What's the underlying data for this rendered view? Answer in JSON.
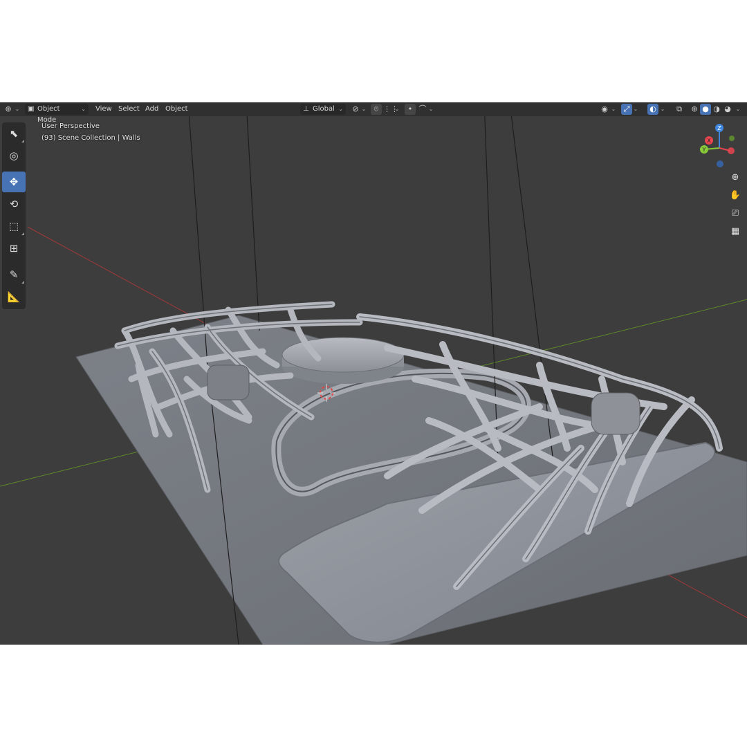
{
  "header": {
    "editor_type_icon": "editor-type-icon",
    "mode_label": "Object Mode",
    "menus": [
      "View",
      "Select",
      "Add",
      "Object"
    ],
    "orientation_label": "Global",
    "icons": {
      "pivot": "pivot-icon",
      "snap": "snap-icon",
      "proportional": "proportional-edit-icon",
      "visibility": "visibility-icon",
      "gizmo": "gizmo-toggle-icon",
      "overlay": "overlay-icon",
      "xray": "xray-icon",
      "shading": [
        "wireframe-shading-icon",
        "solid-shading-icon",
        "material-shading-icon",
        "rendered-shading-icon"
      ]
    }
  },
  "viewport": {
    "view_name": "User Perspective",
    "collection_info": "(93) Scene Collection | Walls"
  },
  "toolbar": {
    "tools": [
      {
        "name": "select-tool",
        "icon": "select-box-icon",
        "active": false
      },
      {
        "name": "cursor-tool",
        "icon": "cursor-icon",
        "active": false
      },
      {
        "name": "move-tool",
        "icon": "move-icon",
        "active": true
      },
      {
        "name": "rotate-tool",
        "icon": "rotate-icon",
        "active": false
      },
      {
        "name": "scale-tool",
        "icon": "scale-icon",
        "active": false
      },
      {
        "name": "transform-tool",
        "icon": "transform-icon",
        "active": false
      },
      {
        "name": "annotate-tool",
        "icon": "annotate-icon",
        "active": false
      },
      {
        "name": "measure-tool",
        "icon": "measure-icon",
        "active": false
      }
    ]
  },
  "gizmo": {
    "axes": {
      "x": "X",
      "y": "Y",
      "z": "Z"
    },
    "colors": {
      "x": "#e8454f",
      "y": "#8ac93a",
      "z": "#3f86dc"
    }
  },
  "navigation": [
    "zoom-icon",
    "hand-pan-icon",
    "camera-icon",
    "grid-ortho-icon"
  ],
  "colors": {
    "viewport_bg": "#3d3d3d",
    "header_bg": "#303030",
    "accent": "#4772b3",
    "x_axis_line": "#a33838",
    "y_axis_line": "#5f8a2a"
  }
}
